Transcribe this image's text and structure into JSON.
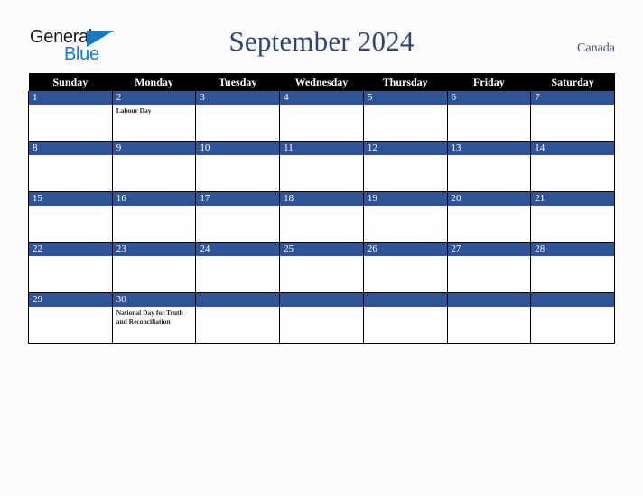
{
  "brand": {
    "name_part1": "General",
    "name_part2": "Blue",
    "triangle_color": "#1878be",
    "text_color": "#1a1a1a"
  },
  "header": {
    "title": "September 2024",
    "country": "Canada",
    "title_color": "#2f4470"
  },
  "calendar": {
    "weekday_headers": [
      "Sunday",
      "Monday",
      "Tuesday",
      "Wednesday",
      "Thursday",
      "Friday",
      "Saturday"
    ],
    "header_bg": "#000000",
    "header_text_color": "#ffffff",
    "daynum_bg": "#2f5496",
    "daynum_text_color": "#ffffff",
    "cell_bg": "#fdfdfd",
    "border_color": "#000000",
    "weeks": [
      [
        {
          "day": "1",
          "events": []
        },
        {
          "day": "2",
          "events": [
            "Labour Day"
          ]
        },
        {
          "day": "3",
          "events": []
        },
        {
          "day": "4",
          "events": []
        },
        {
          "day": "5",
          "events": []
        },
        {
          "day": "6",
          "events": []
        },
        {
          "day": "7",
          "events": []
        }
      ],
      [
        {
          "day": "8",
          "events": []
        },
        {
          "day": "9",
          "events": []
        },
        {
          "day": "10",
          "events": []
        },
        {
          "day": "11",
          "events": []
        },
        {
          "day": "12",
          "events": []
        },
        {
          "day": "13",
          "events": []
        },
        {
          "day": "14",
          "events": []
        }
      ],
      [
        {
          "day": "15",
          "events": []
        },
        {
          "day": "16",
          "events": []
        },
        {
          "day": "17",
          "events": []
        },
        {
          "day": "18",
          "events": []
        },
        {
          "day": "19",
          "events": []
        },
        {
          "day": "20",
          "events": []
        },
        {
          "day": "21",
          "events": []
        }
      ],
      [
        {
          "day": "22",
          "events": []
        },
        {
          "day": "23",
          "events": []
        },
        {
          "day": "24",
          "events": []
        },
        {
          "day": "25",
          "events": []
        },
        {
          "day": "26",
          "events": []
        },
        {
          "day": "27",
          "events": []
        },
        {
          "day": "28",
          "events": []
        }
      ],
      [
        {
          "day": "29",
          "events": []
        },
        {
          "day": "30",
          "events": [
            "National Day for Truth and Reconciliation"
          ]
        },
        {
          "day": "",
          "events": []
        },
        {
          "day": "",
          "events": []
        },
        {
          "day": "",
          "events": []
        },
        {
          "day": "",
          "events": []
        },
        {
          "day": "",
          "events": []
        }
      ]
    ]
  }
}
